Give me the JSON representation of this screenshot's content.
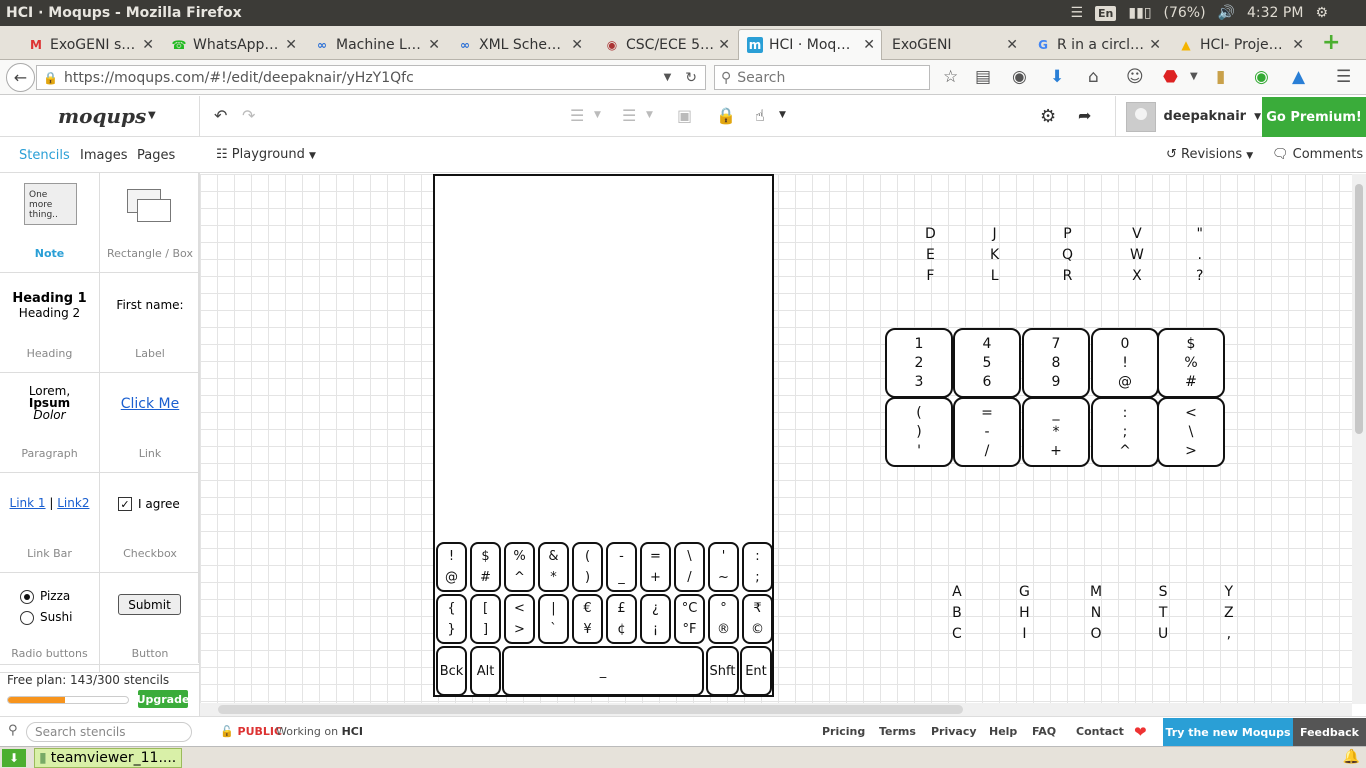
{
  "system": {
    "window_title": "HCI · Moqups - Mozilla Firefox",
    "keyboard_layout": "En",
    "battery": "(76%)",
    "clock": "4:32 PM"
  },
  "tabs": [
    {
      "title": "ExoGENI s…",
      "icon": "gmail-icon"
    },
    {
      "title": "WhatsApp…",
      "icon": "whatsapp-icon"
    },
    {
      "title": "Machine L…",
      "icon": "coursera-icon"
    },
    {
      "title": "XML Sche…",
      "icon": "coursera-icon"
    },
    {
      "title": "CSC/ECE 5…",
      "icon": "moodle-icon"
    },
    {
      "title": "HCI · Moq…",
      "icon": "moqups-icon"
    },
    {
      "title": "ExoGENI",
      "icon": "blank-icon"
    },
    {
      "title": "R in a circl…",
      "icon": "google-icon"
    },
    {
      "title": "HCI- Proje…",
      "icon": "drive-icon"
    }
  ],
  "nav": {
    "url": "https://moqups.com/#!/edit/deepaknair/yHzY1Qfc",
    "search_placeholder": "Search"
  },
  "app": {
    "logo": "moqups",
    "username": "deepaknair",
    "premium_label": "Go Premium!"
  },
  "subbar": {
    "tabs": [
      "Stencils",
      "Images",
      "Pages"
    ],
    "page_name": "Playground",
    "revisions": "Revisions",
    "comments": "Comments"
  },
  "stencils": {
    "note_text": "One more thing..",
    "captions": [
      "Note",
      "Rectangle / Box",
      "Heading",
      "Label",
      "Paragraph",
      "Link",
      "Link Bar",
      "Checkbox",
      "Radio buttons",
      "Button"
    ],
    "heading1": "Heading 1",
    "heading2": "Heading 2",
    "label_text": "First name:",
    "para_l1": "Lorem,",
    "para_l2": "Ipsum",
    "para_l3": "Dolor",
    "link_text": "Click Me",
    "linkbar": [
      "Link 1",
      "|",
      "Link2"
    ],
    "checkbox_text": "I agree",
    "radio1": "Pizza",
    "radio2": "Sushi",
    "button_text": "Submit"
  },
  "plan": {
    "text": "Free plan: 143/300 stencils",
    "used_fraction": 0.477,
    "upgrade": "Upgrade"
  },
  "footer": {
    "search_placeholder": "Search stencils",
    "public": "PUBLIC",
    "working_prefix": "Working on",
    "working_project": "HCI",
    "links": [
      "Pricing",
      "Terms",
      "Privacy",
      "Help",
      "FAQ",
      "Contact"
    ],
    "try_new": "Try the new Moqups",
    "feedback": "Feedback"
  },
  "download": {
    "filename": "teamviewer_11...."
  },
  "canvas": {
    "keyboard_row1": [
      [
        "!",
        "@"
      ],
      [
        "$",
        "#"
      ],
      [
        "%",
        "^"
      ],
      [
        "&",
        "*"
      ],
      [
        "(",
        ")"
      ],
      [
        "-",
        "_"
      ],
      [
        "=",
        "+"
      ],
      [
        "\\",
        "/"
      ],
      [
        "'",
        "~"
      ],
      [
        ":",
        ";"
      ]
    ],
    "keyboard_row2": [
      [
        "{",
        "}"
      ],
      [
        "[",
        "]"
      ],
      [
        "<",
        ">"
      ],
      [
        "|",
        "`"
      ],
      [
        "€",
        "¥"
      ],
      [
        "£",
        "¢"
      ],
      [
        "¿",
        "¡"
      ],
      [
        "°C",
        "°F"
      ],
      [
        "°",
        "®"
      ],
      [
        "₹",
        "©"
      ]
    ],
    "keyboard_row3": [
      "Bck",
      "Alt",
      "_",
      "Shft",
      "Ent"
    ],
    "letters_top": [
      [
        "D",
        "E",
        "F"
      ],
      [
        "J",
        "K",
        "L"
      ],
      [
        "P",
        "Q",
        "R"
      ],
      [
        "V",
        "W",
        "X"
      ],
      [
        "\"",
        ".",
        "?"
      ]
    ],
    "grid_row1": [
      [
        "1",
        "2",
        "3"
      ],
      [
        "4",
        "5",
        "6"
      ],
      [
        "7",
        "8",
        "9"
      ],
      [
        "0",
        "!",
        "@"
      ],
      [
        "$",
        "%",
        "#"
      ]
    ],
    "grid_row2": [
      [
        "(",
        ")",
        "'"
      ],
      [
        "=",
        "-",
        "/"
      ],
      [
        "_",
        "*",
        "+"
      ],
      [
        ":",
        ";",
        "^"
      ],
      [
        "<",
        "\\",
        ">"
      ]
    ],
    "letters_bottom": [
      [
        "A",
        "B",
        "C"
      ],
      [
        "G",
        "H",
        "I"
      ],
      [
        "M",
        "N",
        "O"
      ],
      [
        "S",
        "T",
        "U"
      ],
      [
        "Y",
        "Z",
        ","
      ]
    ]
  }
}
